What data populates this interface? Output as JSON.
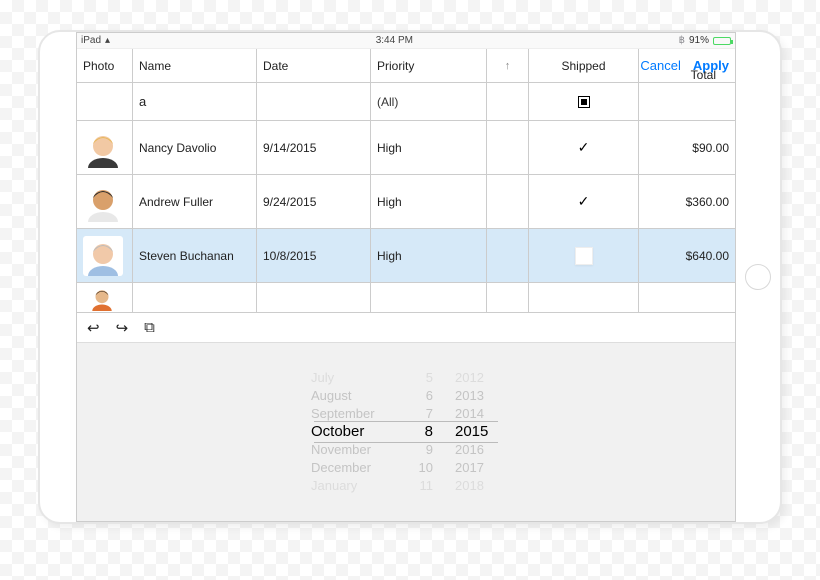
{
  "statusbar": {
    "device": "iPad",
    "time": "3:44 PM",
    "battery": "91%"
  },
  "header": {
    "photo": "Photo",
    "name": "Name",
    "date": "Date",
    "priority": "Priority",
    "shipped": "Shipped",
    "total": "Total",
    "cancel": "Cancel",
    "apply": "Apply"
  },
  "filter": {
    "name_value": "a",
    "priority_value": "(All)"
  },
  "rows": [
    {
      "name": "Nancy Davolio",
      "date": "9/14/2015",
      "priority": "High",
      "shipped": true,
      "total": "$90.00",
      "selected": false
    },
    {
      "name": "Andrew Fuller",
      "date": "9/24/2015",
      "priority": "High",
      "shipped": true,
      "total": "$360.00",
      "selected": false
    },
    {
      "name": "Steven Buchanan",
      "date": "10/8/2015",
      "priority": "High",
      "shipped": false,
      "total": "$640.00",
      "selected": true
    }
  ],
  "picker": {
    "months": [
      "July",
      "August",
      "September",
      "October",
      "November",
      "December",
      "January"
    ],
    "days": [
      "5",
      "6",
      "7",
      "8",
      "9",
      "10",
      "11"
    ],
    "years": [
      "2012",
      "2013",
      "2014",
      "2015",
      "2016",
      "2017",
      "2018"
    ],
    "selected_index": 3
  }
}
